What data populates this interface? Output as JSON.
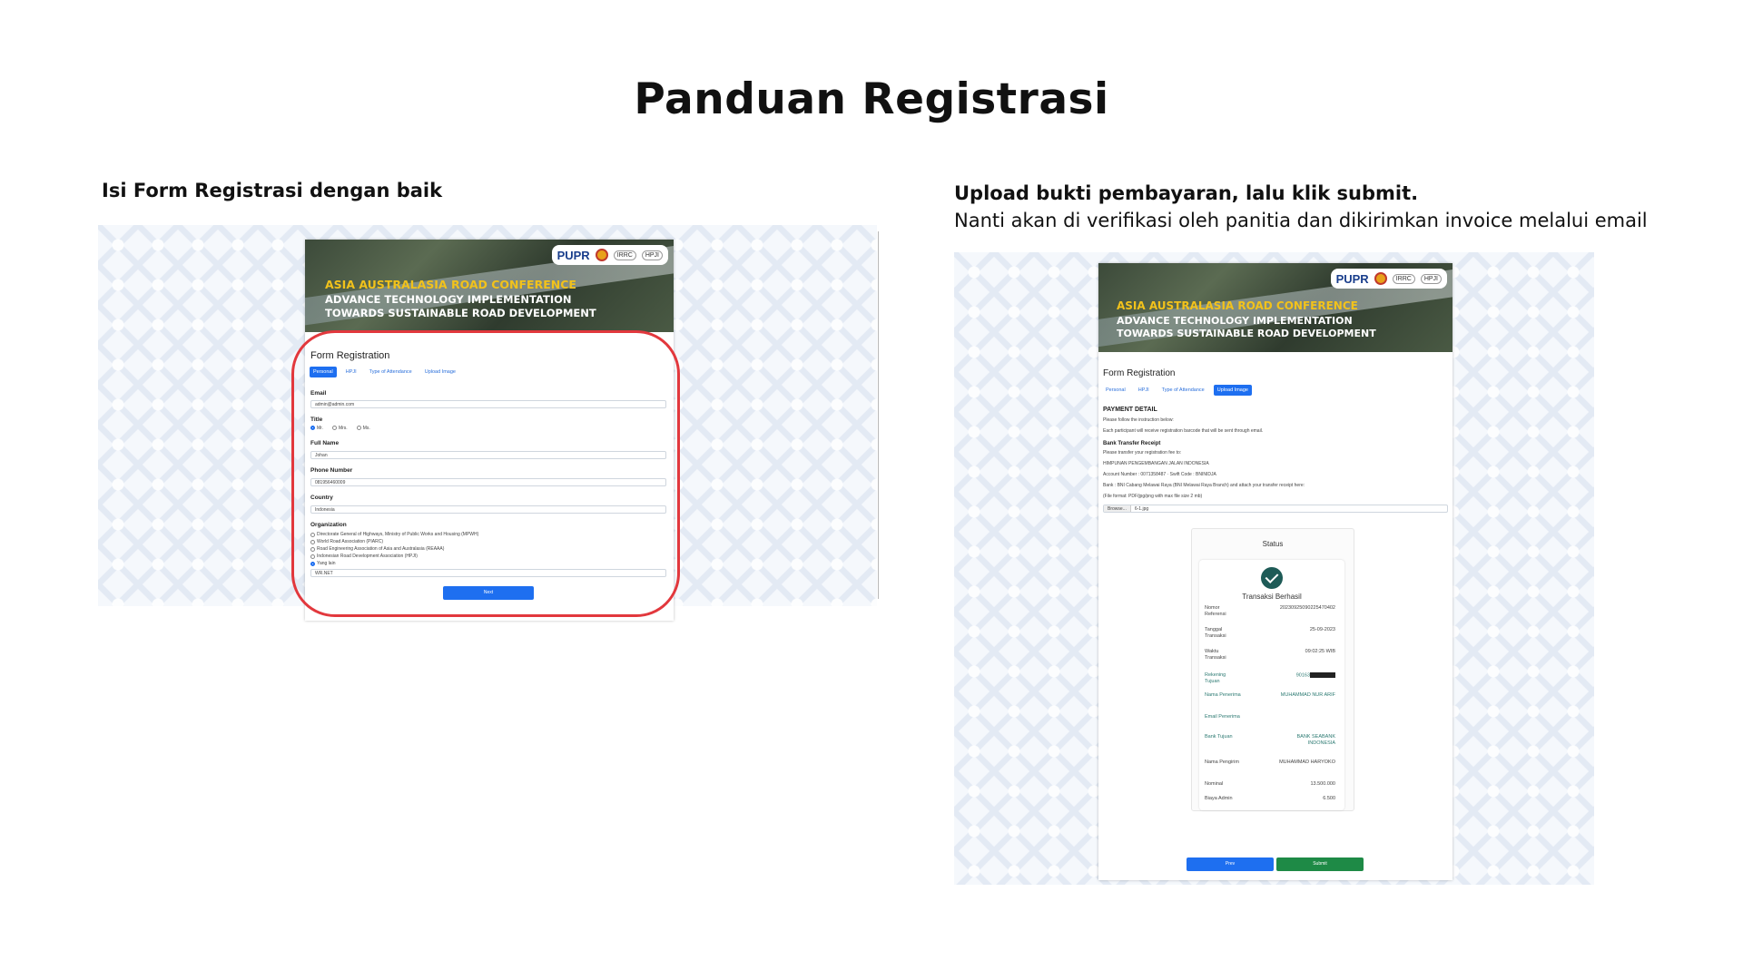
{
  "page": {
    "title": "Panduan Registrasi",
    "left_caption": "Isi Form Registrasi dengan baik",
    "right_caption_bold": "Upload bukti pembayaran, lalu klik submit.",
    "right_caption": "Nanti akan di verifikasi oleh panitia dan dikirimkan invoice melalui email"
  },
  "banner": {
    "logo_pupr": "PUPR",
    "logo_small_1": "IRRC",
    "logo_small_2": "HPJI",
    "line1": "ASIA AUSTRALASIA ROAD CONFERENCE",
    "line2": "ADVANCE TECHNOLOGY IMPLEMENTATION",
    "line3": "TOWARDS SUSTAINABLE ROAD DEVELOPMENT"
  },
  "left_form": {
    "title": "Form Registration",
    "tabs": [
      "Personal",
      "HPJI",
      "Type of Attendance",
      "Upload Image"
    ],
    "email_label": "Email",
    "email_value": "admin@admin.com",
    "title_label": "Title",
    "title_options": [
      "Mr.",
      "Mrs.",
      "Ms."
    ],
    "fullname_label": "Full Name",
    "fullname_value": "Johan",
    "phone_label": "Phone Number",
    "phone_value": "081956460009",
    "country_label": "Country",
    "country_value": "Indonesia",
    "org_label": "Organization",
    "org_options": [
      "Directorate General of Highways, Ministry of Public Works and Housing (MPWH)",
      "World Road Association (PIARC)",
      "Road Engineering Association of Asia and Australasia (REAAA)",
      "Indonesian Road Development Association (HPJI)",
      "Yang lain"
    ],
    "org_other_value": "WR.NET",
    "next_label": "Next"
  },
  "right_form": {
    "title": "Form Registration",
    "tabs": [
      "Personal",
      "HPJI",
      "Type of Attendance",
      "Upload Image"
    ],
    "payment_header": "PAYMENT DETAIL",
    "payment_line1": "Please follow the instruction below:",
    "payment_line2": "Each participant will receive registration barcode that will be sent through email.",
    "bank_header": "Bank Transfer Receipt",
    "bank_line1": "Please transfer your registration fee to:",
    "bank_line2": "HIMPUNAN PENGEMBANGAN JALAN INDONESIA",
    "bank_line3": "Account Number : 0071358487 · Swift Code : BNINIDJA",
    "bank_line4": "Bank : BNI Cabang Melawai Raya (BNI Melawai Raya Branch) and attach your transfer receipt here:",
    "bank_line5": "(File format: PDF/jpg/png with max file size 2 mb)",
    "browse_label": "Browse...",
    "file_name": "6-1.jpg",
    "status_title": "Status",
    "tx_success": "Transaksi Berhasil",
    "rows": [
      {
        "k": "Nomor Referensi",
        "v": "20230925090225470402"
      },
      {
        "k": "Tanggal Transaksi",
        "v": "25-09-2023"
      },
      {
        "k": "Waktu Transaksi",
        "v": "09:02:25 WIB"
      },
      {
        "k": "Rekening Tujuan",
        "v": "90163"
      },
      {
        "k": "Nama Penerima",
        "v": "MUHAMMAD NUR ARIF"
      },
      {
        "k": "Email Penerima",
        "v": ""
      },
      {
        "k": "Bank Tujuan",
        "v": "BANK SEABANK INDONESIA"
      },
      {
        "k": "Nama Pengirim",
        "v": "MUHAMMAD HARYOKO"
      },
      {
        "k": "Nominal",
        "v": "13.500.000"
      },
      {
        "k": "Biaya Admin",
        "v": "6.500"
      }
    ],
    "prev_label": "Prev",
    "submit_label": "Submit"
  },
  "colors": {
    "accent_blue": "#1e6ff0",
    "submit_green": "#1e8a46",
    "highlight_red": "#e2383d",
    "banner_yellow": "#f2c21b"
  }
}
